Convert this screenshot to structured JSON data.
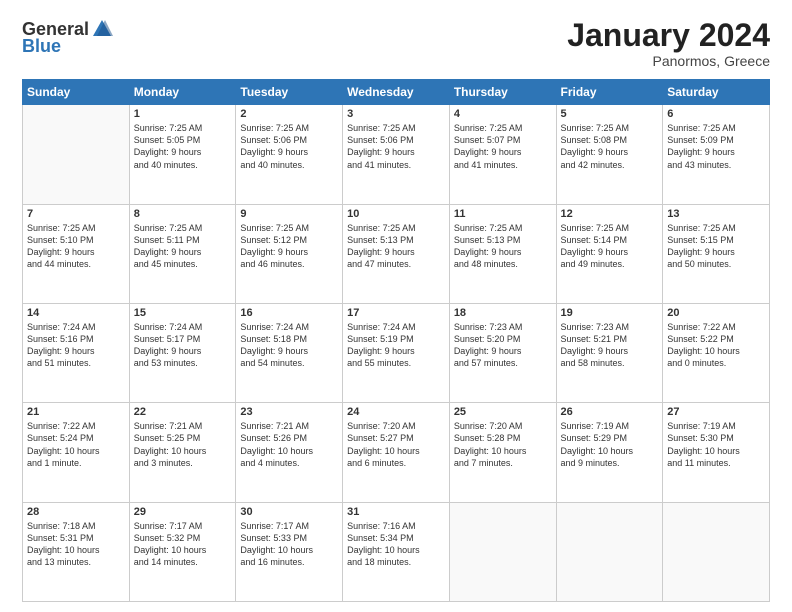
{
  "header": {
    "logo": {
      "general": "General",
      "blue": "Blue"
    },
    "title": "January 2024",
    "subtitle": "Panormos, Greece"
  },
  "weekdays": [
    "Sunday",
    "Monday",
    "Tuesday",
    "Wednesday",
    "Thursday",
    "Friday",
    "Saturday"
  ],
  "weeks": [
    [
      {
        "day": "",
        "info": ""
      },
      {
        "day": "1",
        "info": "Sunrise: 7:25 AM\nSunset: 5:05 PM\nDaylight: 9 hours\nand 40 minutes."
      },
      {
        "day": "2",
        "info": "Sunrise: 7:25 AM\nSunset: 5:06 PM\nDaylight: 9 hours\nand 40 minutes."
      },
      {
        "day": "3",
        "info": "Sunrise: 7:25 AM\nSunset: 5:06 PM\nDaylight: 9 hours\nand 41 minutes."
      },
      {
        "day": "4",
        "info": "Sunrise: 7:25 AM\nSunset: 5:07 PM\nDaylight: 9 hours\nand 41 minutes."
      },
      {
        "day": "5",
        "info": "Sunrise: 7:25 AM\nSunset: 5:08 PM\nDaylight: 9 hours\nand 42 minutes."
      },
      {
        "day": "6",
        "info": "Sunrise: 7:25 AM\nSunset: 5:09 PM\nDaylight: 9 hours\nand 43 minutes."
      }
    ],
    [
      {
        "day": "7",
        "info": "Sunrise: 7:25 AM\nSunset: 5:10 PM\nDaylight: 9 hours\nand 44 minutes."
      },
      {
        "day": "8",
        "info": "Sunrise: 7:25 AM\nSunset: 5:11 PM\nDaylight: 9 hours\nand 45 minutes."
      },
      {
        "day": "9",
        "info": "Sunrise: 7:25 AM\nSunset: 5:12 PM\nDaylight: 9 hours\nand 46 minutes."
      },
      {
        "day": "10",
        "info": "Sunrise: 7:25 AM\nSunset: 5:13 PM\nDaylight: 9 hours\nand 47 minutes."
      },
      {
        "day": "11",
        "info": "Sunrise: 7:25 AM\nSunset: 5:13 PM\nDaylight: 9 hours\nand 48 minutes."
      },
      {
        "day": "12",
        "info": "Sunrise: 7:25 AM\nSunset: 5:14 PM\nDaylight: 9 hours\nand 49 minutes."
      },
      {
        "day": "13",
        "info": "Sunrise: 7:25 AM\nSunset: 5:15 PM\nDaylight: 9 hours\nand 50 minutes."
      }
    ],
    [
      {
        "day": "14",
        "info": "Sunrise: 7:24 AM\nSunset: 5:16 PM\nDaylight: 9 hours\nand 51 minutes."
      },
      {
        "day": "15",
        "info": "Sunrise: 7:24 AM\nSunset: 5:17 PM\nDaylight: 9 hours\nand 53 minutes."
      },
      {
        "day": "16",
        "info": "Sunrise: 7:24 AM\nSunset: 5:18 PM\nDaylight: 9 hours\nand 54 minutes."
      },
      {
        "day": "17",
        "info": "Sunrise: 7:24 AM\nSunset: 5:19 PM\nDaylight: 9 hours\nand 55 minutes."
      },
      {
        "day": "18",
        "info": "Sunrise: 7:23 AM\nSunset: 5:20 PM\nDaylight: 9 hours\nand 57 minutes."
      },
      {
        "day": "19",
        "info": "Sunrise: 7:23 AM\nSunset: 5:21 PM\nDaylight: 9 hours\nand 58 minutes."
      },
      {
        "day": "20",
        "info": "Sunrise: 7:22 AM\nSunset: 5:22 PM\nDaylight: 10 hours\nand 0 minutes."
      }
    ],
    [
      {
        "day": "21",
        "info": "Sunrise: 7:22 AM\nSunset: 5:24 PM\nDaylight: 10 hours\nand 1 minute."
      },
      {
        "day": "22",
        "info": "Sunrise: 7:21 AM\nSunset: 5:25 PM\nDaylight: 10 hours\nand 3 minutes."
      },
      {
        "day": "23",
        "info": "Sunrise: 7:21 AM\nSunset: 5:26 PM\nDaylight: 10 hours\nand 4 minutes."
      },
      {
        "day": "24",
        "info": "Sunrise: 7:20 AM\nSunset: 5:27 PM\nDaylight: 10 hours\nand 6 minutes."
      },
      {
        "day": "25",
        "info": "Sunrise: 7:20 AM\nSunset: 5:28 PM\nDaylight: 10 hours\nand 7 minutes."
      },
      {
        "day": "26",
        "info": "Sunrise: 7:19 AM\nSunset: 5:29 PM\nDaylight: 10 hours\nand 9 minutes."
      },
      {
        "day": "27",
        "info": "Sunrise: 7:19 AM\nSunset: 5:30 PM\nDaylight: 10 hours\nand 11 minutes."
      }
    ],
    [
      {
        "day": "28",
        "info": "Sunrise: 7:18 AM\nSunset: 5:31 PM\nDaylight: 10 hours\nand 13 minutes."
      },
      {
        "day": "29",
        "info": "Sunrise: 7:17 AM\nSunset: 5:32 PM\nDaylight: 10 hours\nand 14 minutes."
      },
      {
        "day": "30",
        "info": "Sunrise: 7:17 AM\nSunset: 5:33 PM\nDaylight: 10 hours\nand 16 minutes."
      },
      {
        "day": "31",
        "info": "Sunrise: 7:16 AM\nSunset: 5:34 PM\nDaylight: 10 hours\nand 18 minutes."
      },
      {
        "day": "",
        "info": ""
      },
      {
        "day": "",
        "info": ""
      },
      {
        "day": "",
        "info": ""
      }
    ]
  ]
}
